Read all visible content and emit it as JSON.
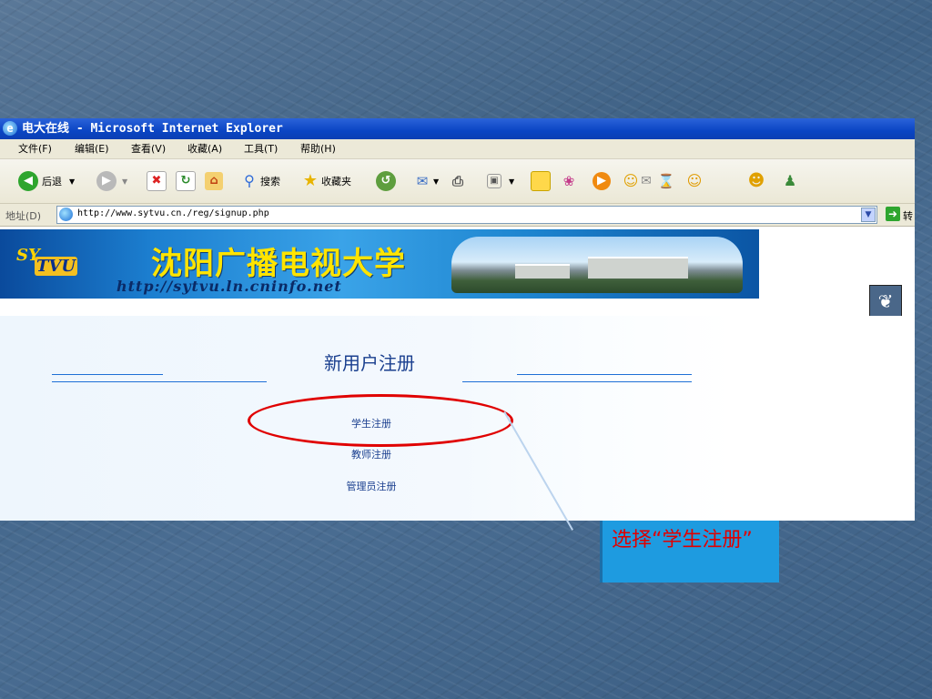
{
  "window": {
    "title": "电大在线 - Microsoft Internet Explorer"
  },
  "menu": [
    "文件(F)",
    "编辑(E)",
    "查看(V)",
    "收藏(A)",
    "工具(T)",
    "帮助(H)"
  ],
  "toolbar": {
    "back_label": "后退",
    "search_label": "搜索",
    "favorites_label": "收藏夹"
  },
  "address": {
    "label": "地址(D)",
    "url": "http://www.sytvu.cn./reg/signup.php",
    "go_label": "转"
  },
  "banner": {
    "logo_text_1": "SY",
    "logo_text_2": "TVU",
    "title": "沈阳广播电视大学",
    "url": "http://sytvu.ln.cninfo.net"
  },
  "form": {
    "heading": "新用户注册",
    "links": [
      "学生注册",
      "教师注册",
      "管理员注册"
    ]
  },
  "callout": {
    "text": "选择“学生注册”"
  },
  "colors": {
    "title_bar": "#0a45c4",
    "highlight": "#e00000",
    "callout_bg": "#1e9be0"
  }
}
